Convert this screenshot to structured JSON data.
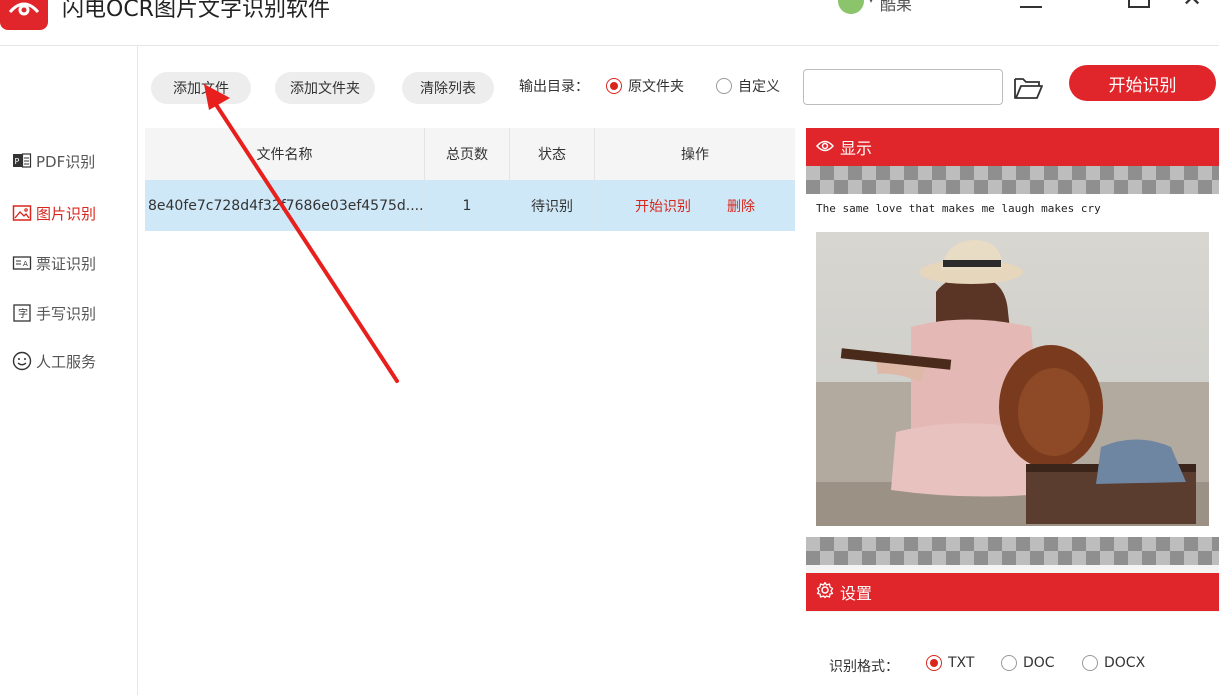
{
  "app": {
    "title": "闪电OCR图片文字识别软件",
    "user_name": "酷果"
  },
  "sidebar": {
    "items": [
      {
        "label": "PDF识别",
        "icon": "pdf-icon"
      },
      {
        "label": "图片识别",
        "icon": "image-icon",
        "active": true
      },
      {
        "label": "票证识别",
        "icon": "id-card-icon"
      },
      {
        "label": "手写识别",
        "icon": "handwriting-icon"
      },
      {
        "label": "人工服务",
        "icon": "smiley-icon"
      }
    ]
  },
  "toolbar": {
    "add_file": "添加文件",
    "add_folder": "添加文件夹",
    "clear_list": "清除列表",
    "output_label": "输出目录：",
    "output_options": [
      "原文件夹",
      "自定义"
    ],
    "output_selected": "原文件夹",
    "path_value": "",
    "start": "开始识别"
  },
  "table": {
    "columns": [
      "文件名称",
      "总页数",
      "状态",
      "操作"
    ],
    "rows": [
      {
        "name": "8e40fe7c728d4f32f7686e03ef4575d....",
        "pages": "1",
        "status": "待识别",
        "actions": [
          "开始识别",
          "删除"
        ]
      }
    ]
  },
  "preview": {
    "header": "显示",
    "caption": "The same love that makes me laugh makes cry"
  },
  "settings": {
    "header": "设置",
    "format_label": "识别格式：",
    "formats": [
      "TXT",
      "DOC",
      "DOCX"
    ],
    "format_selected": "TXT"
  },
  "colors": {
    "accent": "#e0262b",
    "row_selected": "#cfe8f7"
  }
}
